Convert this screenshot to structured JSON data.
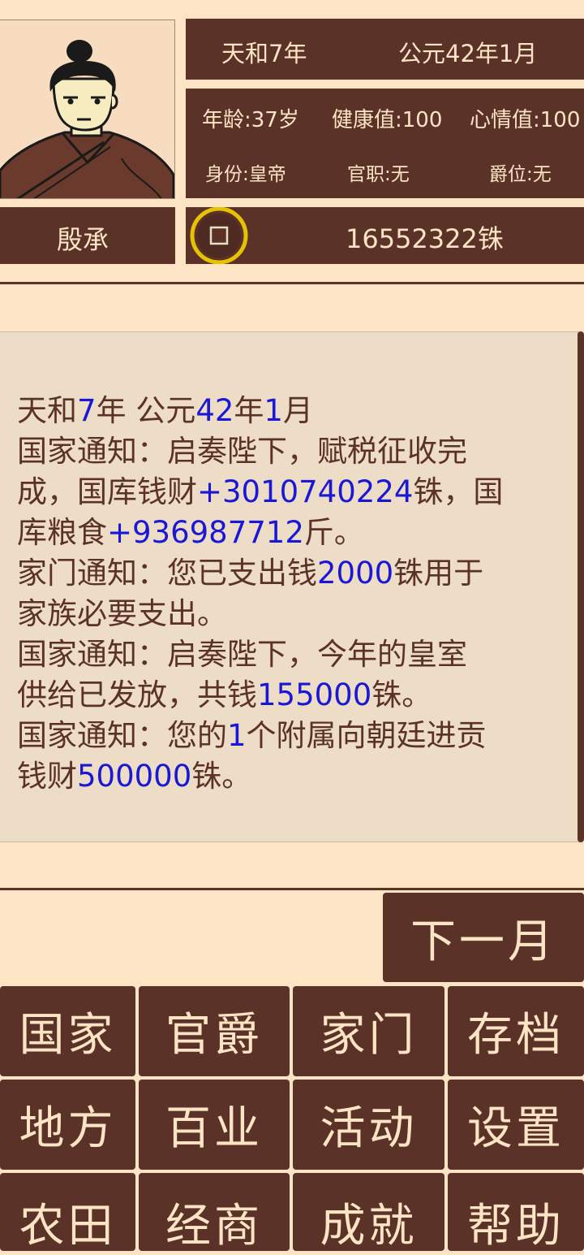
{
  "header": {
    "era": "天和7年",
    "gregorian": "公元42年1月",
    "age": "年龄:37岁",
    "health": "健康值:100",
    "mood": "心情值:100",
    "identity": "身份:皇帝",
    "office": "官职:无",
    "title_rank": "爵位:无",
    "name": "殷承",
    "money": "16552322铢",
    "coin_icon": "coin-icon"
  },
  "log": {
    "lines": [
      [
        {
          "t": "天和"
        },
        {
          "t": "7",
          "n": true
        },
        {
          "t": "年 公元"
        },
        {
          "t": "42",
          "n": true
        },
        {
          "t": "年"
        },
        {
          "t": "1",
          "n": true
        },
        {
          "t": "月"
        }
      ],
      [
        {
          "t": "国家通知：启奏陛下，赋税征收完"
        }
      ],
      [
        {
          "t": "成，国库钱财"
        },
        {
          "t": "+3010740224",
          "n": true
        },
        {
          "t": "铢，国"
        }
      ],
      [
        {
          "t": "库粮食"
        },
        {
          "t": "+936987712",
          "n": true
        },
        {
          "t": "斤。"
        }
      ],
      [
        {
          "t": "家门通知：您已支出钱"
        },
        {
          "t": "2000",
          "n": true
        },
        {
          "t": "铢用于"
        }
      ],
      [
        {
          "t": "家族必要支出。"
        }
      ],
      [
        {
          "t": "国家通知：启奏陛下，今年的皇室"
        }
      ],
      [
        {
          "t": "供给已发放，共钱"
        },
        {
          "t": "155000",
          "n": true
        },
        {
          "t": "铢。"
        }
      ],
      [
        {
          "t": "国家通知：您的"
        },
        {
          "t": "1",
          "n": true
        },
        {
          "t": "个附属向朝廷进贡"
        }
      ],
      [
        {
          "t": "钱财"
        },
        {
          "t": "500000",
          "n": true
        },
        {
          "t": "铢。"
        }
      ]
    ]
  },
  "actions": {
    "next_month": "下一月"
  },
  "menu": {
    "row1": [
      "国家",
      "官爵",
      "家门",
      "存档"
    ],
    "row2": [
      "地方",
      "百业",
      "活动",
      "设置"
    ],
    "row3": [
      "农田",
      "经商",
      "成就",
      "帮助"
    ]
  },
  "colors": {
    "background": "#fce4c4",
    "panel": "#5b3228",
    "log_bg": "#eddcc6",
    "number_blue": "#1a18d4",
    "coin": "#e6c300"
  }
}
